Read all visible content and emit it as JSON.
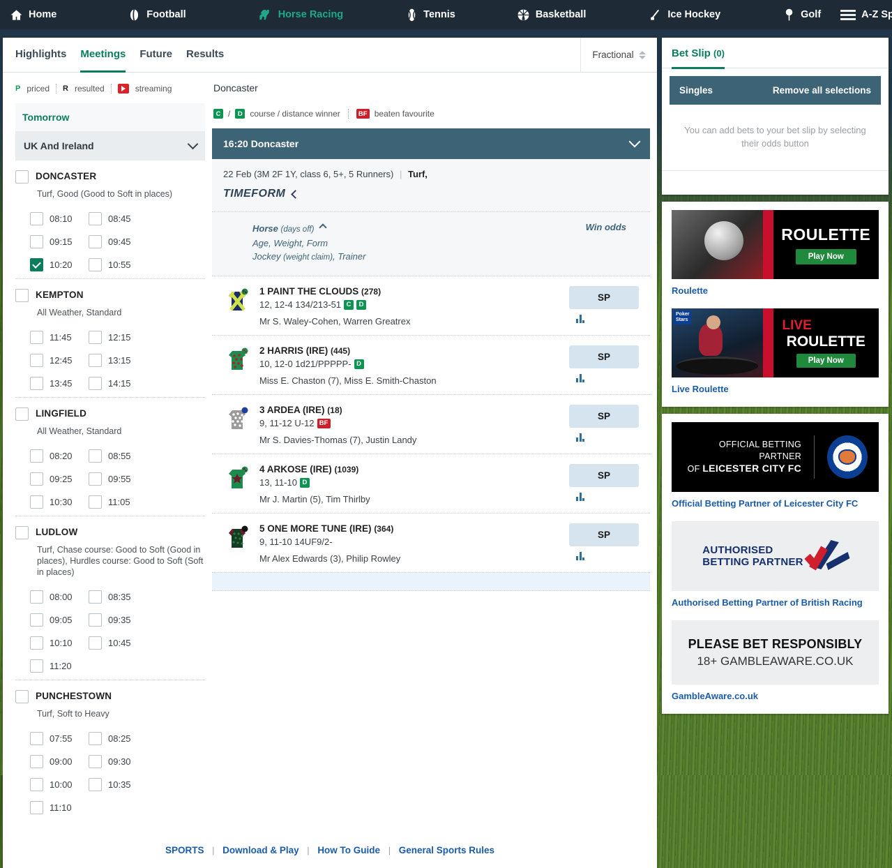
{
  "topnav": {
    "items": [
      {
        "label": "Home",
        "icon": "home-icon",
        "active": false
      },
      {
        "label": "Football",
        "icon": "football-icon",
        "active": false
      },
      {
        "label": "Horse Racing",
        "icon": "horse-racing-icon",
        "active": true
      },
      {
        "label": "Tennis",
        "icon": "tennis-icon",
        "active": false
      },
      {
        "label": "Basketball",
        "icon": "basketball-icon",
        "active": false
      },
      {
        "label": "Ice Hockey",
        "icon": "ice-hockey-icon",
        "active": false
      },
      {
        "label": "Golf",
        "icon": "golf-icon",
        "active": false
      },
      {
        "label": "A-Z Sports",
        "icon": "hamburger-icon",
        "active": false
      }
    ]
  },
  "tabs": [
    {
      "label": "Highlights",
      "active": false
    },
    {
      "label": "Meetings",
      "active": true
    },
    {
      "label": "Future",
      "active": false
    },
    {
      "label": "Results",
      "active": false
    }
  ],
  "odds_format": {
    "value": "Fractional"
  },
  "sidebar": {
    "legend": [
      {
        "mark": "P",
        "label": "priced"
      },
      {
        "mark": "R",
        "label": "resulted"
      },
      {
        "mark": "stream-icon",
        "label": "streaming"
      }
    ],
    "day_label": "Tomorrow",
    "region_label": "UK And Ireland",
    "courses": [
      {
        "name": "DONCASTER",
        "going": "Turf, Good (Good to Soft in places)",
        "checked": false,
        "times": [
          {
            "time": "08:10",
            "checked": false
          },
          {
            "time": "08:45",
            "checked": false
          },
          {
            "time": "09:15",
            "checked": false
          },
          {
            "time": "09:45",
            "checked": false
          },
          {
            "time": "10:20",
            "checked": true
          },
          {
            "time": "10:55",
            "checked": false
          }
        ]
      },
      {
        "name": "KEMPTON",
        "going": "All Weather, Standard",
        "checked": false,
        "times": [
          {
            "time": "11:45",
            "checked": false
          },
          {
            "time": "12:15",
            "checked": false
          },
          {
            "time": "12:45",
            "checked": false
          },
          {
            "time": "13:15",
            "checked": false
          },
          {
            "time": "13:45",
            "checked": false
          },
          {
            "time": "14:15",
            "checked": false
          }
        ]
      },
      {
        "name": "LINGFIELD",
        "going": "All Weather, Standard",
        "checked": false,
        "times": [
          {
            "time": "08:20",
            "checked": false
          },
          {
            "time": "08:55",
            "checked": false
          },
          {
            "time": "09:25",
            "checked": false
          },
          {
            "time": "09:55",
            "checked": false
          },
          {
            "time": "10:30",
            "checked": false
          },
          {
            "time": "11:05",
            "checked": false
          }
        ]
      },
      {
        "name": "LUDLOW",
        "going": "Turf, Chase course: Good to Soft (Good in places), Hurdles course: Good to Soft (Soft in places)",
        "checked": false,
        "times": [
          {
            "time": "08:00",
            "checked": false
          },
          {
            "time": "08:35",
            "checked": false
          },
          {
            "time": "09:05",
            "checked": false
          },
          {
            "time": "09:35",
            "checked": false
          },
          {
            "time": "10:10",
            "checked": false
          },
          {
            "time": "10:45",
            "checked": false
          },
          {
            "time": "11:20",
            "checked": false
          }
        ]
      },
      {
        "name": "PUNCHESTOWN",
        "going": "Turf, Soft to Heavy",
        "checked": false,
        "times": [
          {
            "time": "07:55",
            "checked": false
          },
          {
            "time": "08:25",
            "checked": false
          },
          {
            "time": "09:00",
            "checked": false
          },
          {
            "time": "09:30",
            "checked": false
          },
          {
            "time": "10:00",
            "checked": false
          },
          {
            "time": "10:35",
            "checked": false
          },
          {
            "time": "11:10",
            "checked": false
          }
        ]
      }
    ]
  },
  "main": {
    "venue": "Doncaster",
    "key": {
      "c": "C",
      "d": "D",
      "slash": "/",
      "course_distance_label": "course / distance winner",
      "bf": "BF",
      "beaten_favourite_label": "beaten favourite"
    },
    "race_header": "16:20 Doncaster",
    "race_meta": "22 Feb (3M 2F 1Y, class 6, 5+, 5 Runners)",
    "race_surface": "Turf,",
    "timeform_label": "TIMEFORM",
    "columns": {
      "horse": "Horse",
      "days_off": "(days off)",
      "age_weight_form": "Age, Weight, Form",
      "jockey": "Jockey",
      "weight_claim": "(weight claim)",
      "trainer": ", Trainer",
      "win_odds": "Win odds"
    },
    "runners": [
      {
        "number": "1",
        "name": "PAINT THE CLOUDS",
        "days": "(278)",
        "form": "12, 12-4 134/213-51",
        "badges": [
          "C",
          "D"
        ],
        "people": "Mr S. Waley-Cohen, Warren Greatrex",
        "odds": "SP",
        "silk": "navy-yellow-cross"
      },
      {
        "number": "2",
        "name": "HARRIS (IRE)",
        "days": "(445)",
        "form": "10, 12-0 1d21/PPPPP-",
        "badges": [
          "D"
        ],
        "people": "Miss E. Chaston (7), Miss E. Smith-Chaston",
        "odds": "SP",
        "silk": "green-red-spots"
      },
      {
        "number": "3",
        "name": "ARDEA (IRE)",
        "days": "(18)",
        "form": "9, 11-12 U-12",
        "badges": [
          "BF"
        ],
        "people": "Mr S. Davies-Thomas (7), Justin Landy",
        "odds": "SP",
        "silk": "grey-white-spots"
      },
      {
        "number": "4",
        "name": "ARKOSE (IRE)",
        "days": "(1039)",
        "form": "13, 11-10",
        "badges": [
          "D"
        ],
        "people": "Mr J. Martin (5), Tim Thirlby",
        "odds": "SP",
        "silk": "green-maroon-star"
      },
      {
        "number": "5",
        "name": "ONE MORE TUNE (IRE)",
        "days": "(364)",
        "form": "9, 11-10 14UF9/2-",
        "badges": [],
        "people": "Mr Alex Edwards (3), Philip Rowley",
        "odds": "SP",
        "silk": "darkgreen-spots-maroon"
      }
    ]
  },
  "footer": {
    "links": [
      "SPORTS",
      "Download & Play",
      "How To Guide",
      "General Sports Rules"
    ]
  },
  "betslip": {
    "title": "Bet Slip",
    "count": "(0)",
    "singles_label": "Singles",
    "remove_all_label": "Remove all selections",
    "empty_message": "You can add bets to your bet slip by selecting their odds button"
  },
  "promos": [
    {
      "caption": "Roulette",
      "title": "ROULETTE",
      "cta": "Play Now",
      "live": ""
    },
    {
      "caption": "Live Roulette",
      "title": "ROULETTE",
      "cta": "Play Now",
      "live": "LIVE"
    }
  ],
  "partners": [
    {
      "line1": "OFFICIAL BETTING PARTNER",
      "line2_prefix": "OF ",
      "line2": "LEICESTER CITY FC",
      "caption": "Official Betting Partner of Leicester City FC"
    },
    {
      "logo_line1": "AUTHORISED",
      "logo_line2": "BETTING PARTNER",
      "caption": "Authorised Betting Partner of British Racing"
    },
    {
      "ga_line1": "PLEASE BET RESPONSIBLY",
      "ga_line2": "18+ GAMBLEAWARE.CO.UK",
      "caption": "GambleAware.co.uk"
    }
  ],
  "colors": {
    "nav_bg": "#1e2a36",
    "accent_green": "#0b7d5e",
    "race_header_blue": "#3d6377",
    "sp_button": "#d6e4ef",
    "link_blue": "#1b5ca8",
    "badge_green": "#0b9550",
    "badge_red": "#c9202a"
  }
}
